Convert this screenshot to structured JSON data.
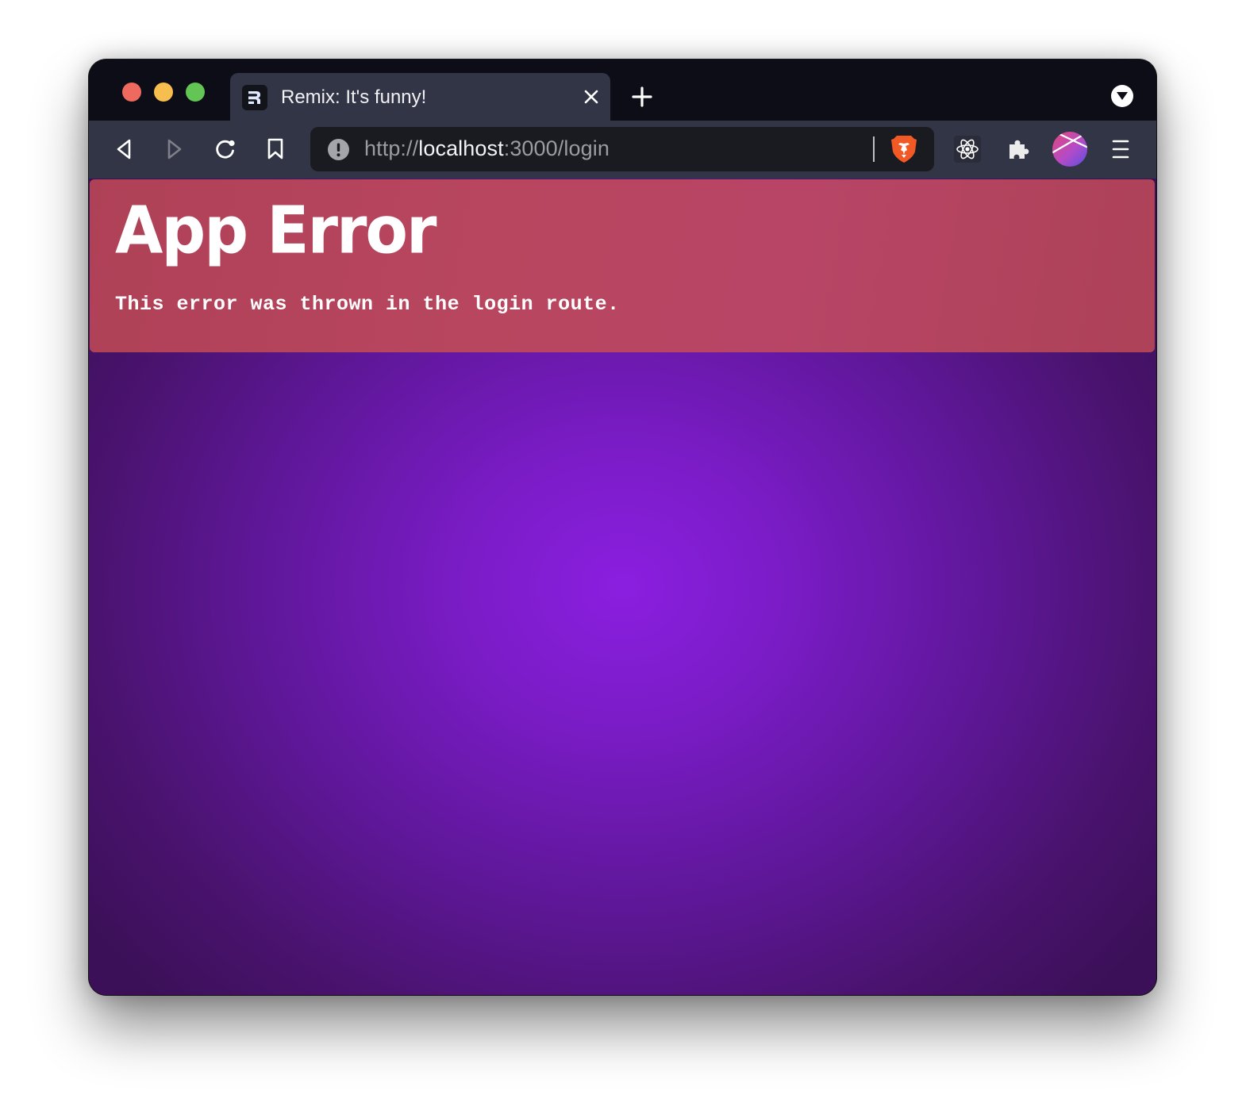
{
  "window": {
    "controls": [
      "close",
      "minimize",
      "zoom"
    ]
  },
  "tab": {
    "favicon": "remix-logo-icon",
    "title": "Remix: It's funny!",
    "close_icon": "close-icon"
  },
  "tabbar": {
    "new_tab_icon": "plus-icon",
    "dropdown_icon": "chevron-down-circle-icon"
  },
  "toolbar": {
    "back_icon": "back-triangle-icon",
    "forward_icon": "forward-triangle-icon",
    "reload_icon": "reload-icon",
    "bookmark_icon": "bookmark-icon",
    "url": {
      "scheme": "http://",
      "host": "localhost",
      "rest": ":3000/login",
      "security_icon": "info-warning-icon"
    },
    "shields_icon": "brave-lion-icon",
    "extensions": [
      "react-devtools-icon",
      "puzzle-piece-icon"
    ],
    "profile_icon": "profile-avatar-icon",
    "menu_icon": "hamburger-menu-icon"
  },
  "colors": {
    "error_panel": "#b8465f",
    "content_center": "#8b1fe0",
    "content_edge": "#3c1059",
    "tabbar_bg": "#0d0d17",
    "toolbar_bg": "#323545",
    "brave_orange": "#f15a24"
  },
  "page": {
    "error_title": "App Error",
    "error_message": "This error was thrown in the login route."
  }
}
